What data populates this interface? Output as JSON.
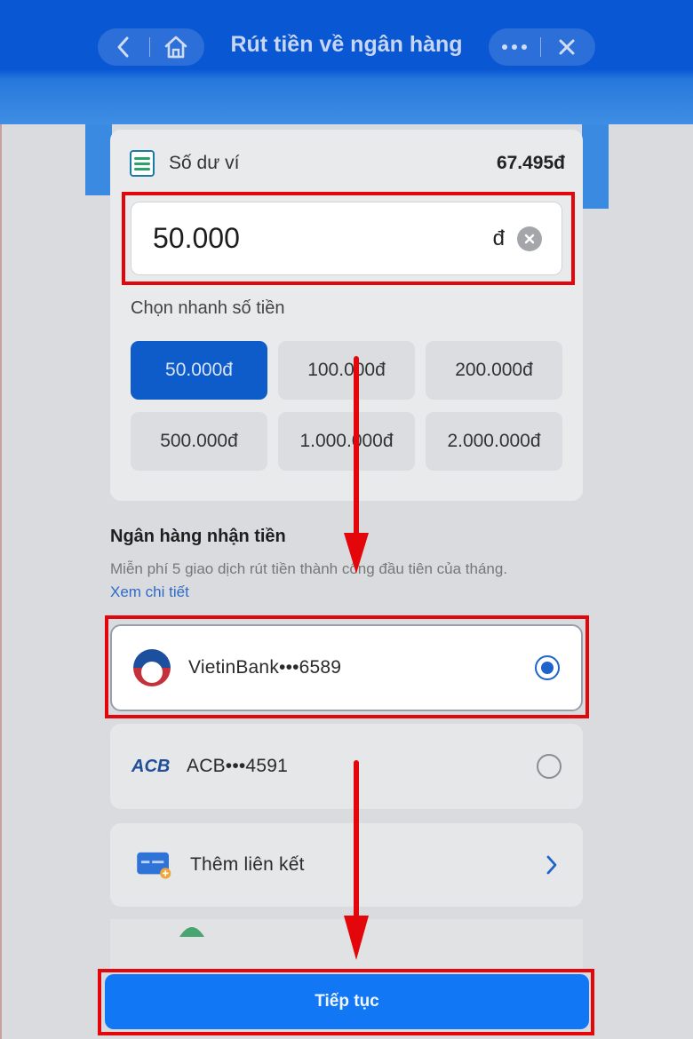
{
  "header": {
    "title": "Rút tiền về ngân hàng",
    "back_icon": "chevron-left-icon",
    "home_icon": "home-icon",
    "more_icon": "more-dots-icon",
    "close_icon": "close-icon"
  },
  "wallet": {
    "icon": "wallet-icon",
    "label": "Số dư ví",
    "balance": "67.495đ"
  },
  "amount_input": {
    "value": "50.000",
    "currency": "đ",
    "clear_icon": "clear-circle-icon"
  },
  "quick_amounts": {
    "label": "Chọn nhanh số tiền",
    "selected": "50.000đ",
    "options": [
      "50.000đ",
      "100.000đ",
      "200.000đ",
      "500.000đ",
      "1.000.000đ",
      "2.000.000đ"
    ]
  },
  "receiving_bank": {
    "title": "Ngân hàng nhận tiền",
    "note": "Miễn phí 5 giao dịch rút tiền thành công đầu tiên của tháng.",
    "note_link": "Xem chi tiết",
    "banks": [
      {
        "name": "VietinBank•••6589",
        "logo": "vietinbank-logo",
        "selected": true
      },
      {
        "name": "ACB•••4591",
        "logo_text": "ACB",
        "selected": false
      }
    ],
    "add_link_label": "Thêm liên kết"
  },
  "continue_button": {
    "label": "Tiếp tục"
  },
  "colors": {
    "header_blue": "#0a57d4",
    "primary_blue": "#1177f4",
    "selected_chip": "#0e5cc9",
    "annotation_red": "#e3060b"
  }
}
